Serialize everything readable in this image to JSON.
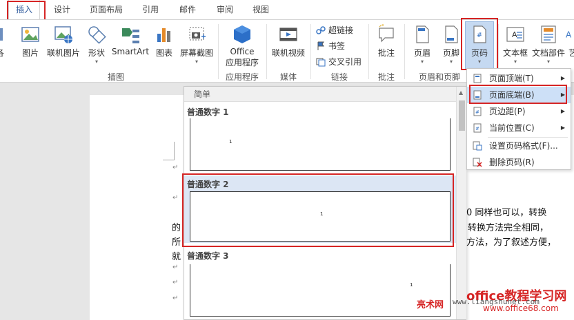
{
  "tabs": [
    {
      "label": "插入",
      "active": true
    },
    {
      "label": "设计"
    },
    {
      "label": "页面布局"
    },
    {
      "label": "引用"
    },
    {
      "label": "邮件"
    },
    {
      "label": "审阅"
    },
    {
      "label": "视图"
    }
  ],
  "ribbon": {
    "left_cut_label": "各",
    "buttons": {
      "picture": "图片",
      "online_picture": "联机图片",
      "shapes": "形状",
      "smartart": "SmartArt",
      "chart": "图表",
      "screenshot": "屏幕截图",
      "office_apps_1": "Office",
      "office_apps_2": "应用程序",
      "online_video": "联机视频",
      "hyperlink": "超链接",
      "bookmark": "书签",
      "crossref": "交叉引用",
      "comment": "批注",
      "header": "页眉",
      "footer": "页脚",
      "page_number": "页码",
      "textbox": "文本框",
      "quickparts": "文档部件",
      "wordart_cut": "艺"
    },
    "groups": {
      "illustrations": "插图",
      "apps": "应用程序",
      "media": "媒体",
      "links": "链接",
      "comments": "批注",
      "header_footer": "页眉和页脚",
      "left_cut": "各"
    }
  },
  "gallery": {
    "section_header": "简单",
    "items": [
      {
        "label": "普通数字 1",
        "num": "1"
      },
      {
        "label": "普通数字 2",
        "num": "1"
      },
      {
        "label": "普通数字 3",
        "num": "1"
      }
    ]
  },
  "menu": {
    "items": [
      {
        "label": "页面顶端(T)",
        "has_sub": true
      },
      {
        "label": "页面底端(B)",
        "has_sub": true
      },
      {
        "label": "页边距(P)",
        "has_sub": true
      },
      {
        "label": "当前位置(C)",
        "has_sub": true
      },
      {
        "label": "设置页码格式(F)..."
      },
      {
        "label": "删除页码(R)"
      }
    ]
  },
  "document": {
    "line1": "0 同样也可以，转换",
    "line2_left": "的",
    "line2_right": "转换方法完全相同，",
    "line3_left": "所",
    "line3_right": "方法，为了叙述方便，",
    "line4_left": "就",
    "para_mark": "↵"
  },
  "watermark": {
    "site_cn": "亮术网",
    "url": "www.liangshunet.com",
    "brand": "office教程学习网",
    "url2": "www.office68.com"
  },
  "colors": {
    "highlight_red": "#d62525",
    "menu_hover": "#cde0f7",
    "gallery_selected": "#dce6f4",
    "accent_blue": "#2b579a"
  }
}
